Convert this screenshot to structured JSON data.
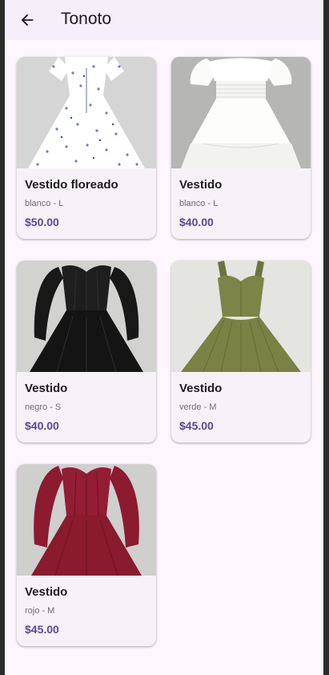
{
  "app_bar": {
    "title": "Tonoto",
    "back_icon": "arrow-left-icon"
  },
  "products": [
    {
      "name": "Vestido floreado",
      "detail": "blanco - L",
      "price": "$50.00",
      "image": "floral-dress-image",
      "color": "#ffffff",
      "accent": "#6b7fc4"
    },
    {
      "name": "Vestido",
      "detail": "blanco - L",
      "price": "$40.00",
      "image": "white-dress-image",
      "color": "#f6f6f4",
      "accent": "#dcdcd8"
    },
    {
      "name": "Vestido",
      "detail": "negro - S",
      "price": "$40.00",
      "image": "black-dress-image",
      "color": "#1c1c1c",
      "accent": "#0e0e0e"
    },
    {
      "name": "Vestido",
      "detail": "verde - M",
      "price": "$45.00",
      "image": "green-dress-image",
      "color": "#7d8447",
      "accent": "#646a36"
    },
    {
      "name": "Vestido",
      "detail": "rojo - M",
      "price": "$45.00",
      "image": "red-dress-image",
      "color": "#8a1a2e",
      "accent": "#6e1224"
    }
  ],
  "colors": {
    "background": "#fdf6fd",
    "app_bar": "#f6eef8",
    "card": "#f7f1f8",
    "price": "#5a4896"
  }
}
